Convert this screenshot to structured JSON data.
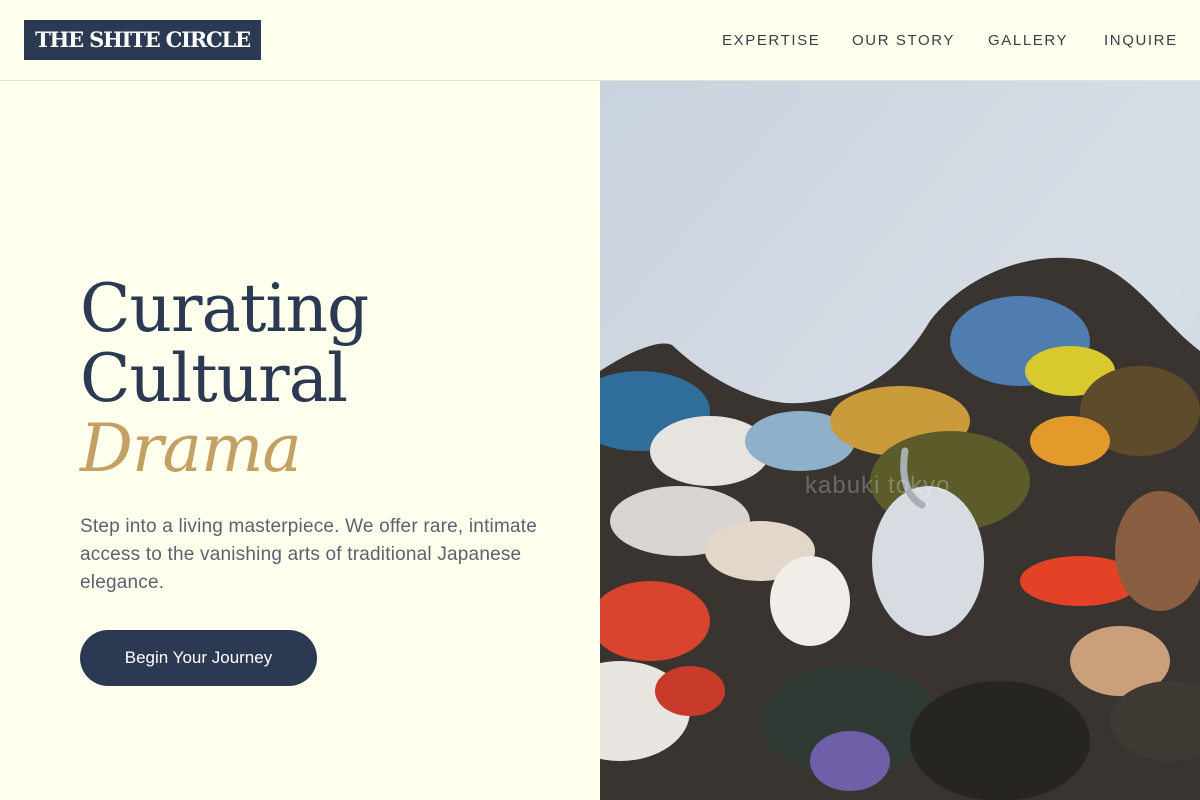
{
  "brand": {
    "logo_text": "THE SHITE CIRCLE"
  },
  "nav": {
    "items": [
      {
        "label": "EXPERTISE"
      },
      {
        "label": "OUR STORY"
      },
      {
        "label": "GALLERY"
      },
      {
        "label": "INQUIRE"
      }
    ]
  },
  "hero": {
    "headline_line1": "Curating",
    "headline_line2": "Cultural",
    "headline_accent": "Drama",
    "subtitle": "Step into a living masterpiece. We offer rare, intimate access to the vanishing arts of traditional Japanese elegance.",
    "cta_label": "Begin Your Journey",
    "image_watermark": "kabuki tokyo"
  },
  "colors": {
    "background": "#FFFFEE",
    "navy": "#2B3A52",
    "gold_accent": "#C3A063",
    "body_text": "#5A6270"
  }
}
